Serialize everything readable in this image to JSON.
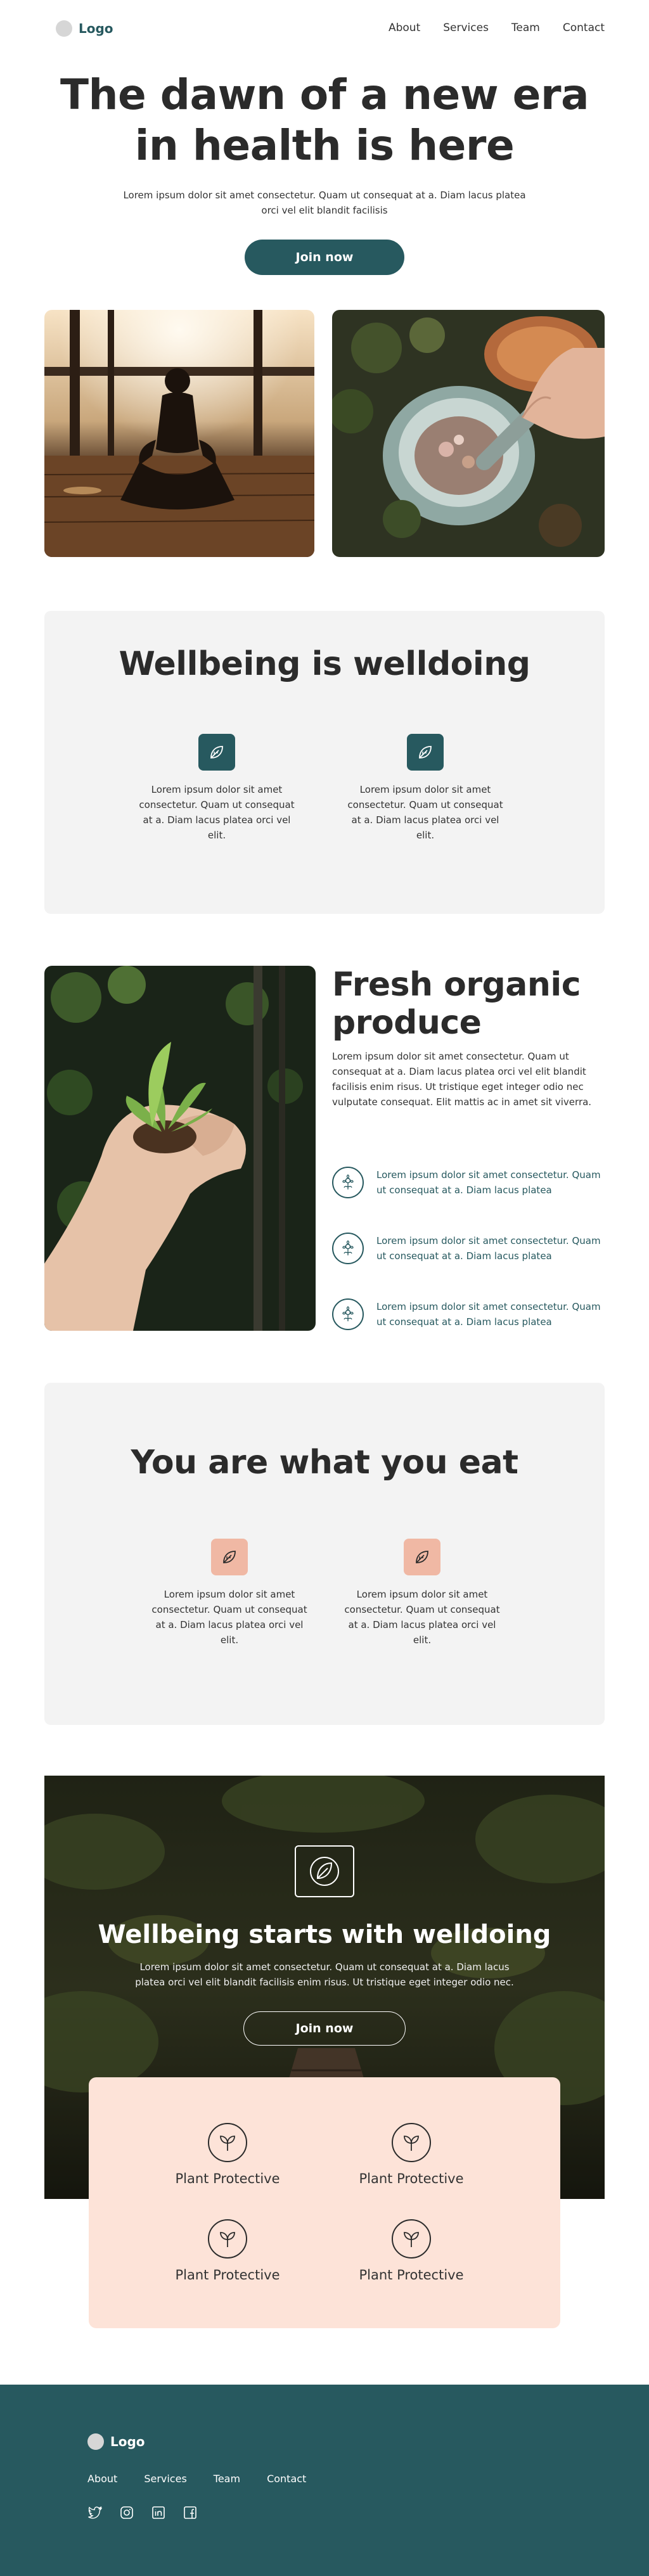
{
  "nav": {
    "logo": "Logo",
    "links": [
      "About",
      "Services",
      "Team",
      "Contact"
    ]
  },
  "hero": {
    "title": "The dawn of a new era in health is here",
    "subtitle": "Lorem ipsum dolor sit amet consectetur. Quam ut consequat at a. Diam lacus platea orci vel elit blandit facilisis",
    "cta": "Join now"
  },
  "wellbeing": {
    "title": "Wellbeing is welldoing",
    "features": [
      {
        "icon": "leaf-icon",
        "text": "Lorem ipsum dolor sit amet consectetur. Quam ut consequat at a. Diam lacus platea orci vel elit."
      },
      {
        "icon": "leaf-icon",
        "text": "Lorem ipsum dolor sit amet consectetur. Quam ut consequat at a. Diam lacus platea orci vel elit."
      }
    ]
  },
  "organic": {
    "title": "Fresh organic produce",
    "body": "Lorem ipsum dolor sit amet consectetur. Quam ut consequat at a. Diam lacus platea orci vel elit blandit facilisis enim risus. Ut tristique eget integer odio nec vulputate consequat. Elit mattis ac in amet sit viverra.",
    "items": [
      {
        "icon": "flower-icon",
        "text": "Lorem ipsum dolor sit amet consectetur. Quam ut consequat at a. Diam lacus platea"
      },
      {
        "icon": "flower-icon",
        "text": "Lorem ipsum dolor sit amet consectetur. Quam ut consequat at a. Diam lacus platea"
      },
      {
        "icon": "flower-icon",
        "text": "Lorem ipsum dolor sit amet consectetur. Quam ut consequat at a. Diam lacus platea"
      }
    ]
  },
  "eat": {
    "title": "You are what you eat",
    "features": [
      {
        "icon": "leaf-icon",
        "text": "Lorem ipsum dolor sit amet consectetur. Quam ut consequat at a. Diam lacus platea orci vel elit."
      },
      {
        "icon": "leaf-icon",
        "text": "Lorem ipsum dolor sit amet consectetur. Quam ut consequat at a. Diam lacus platea orci vel elit."
      }
    ]
  },
  "banner": {
    "title": "Wellbeing starts with welldoing",
    "subtitle": "Lorem ipsum dolor sit amet consectetur. Quam ut consequat at a. Diam lacus platea orci vel elit blandit facilisis enim risus. Ut tristique eget integer odio nec.",
    "cta": "Join now"
  },
  "plants": {
    "items": [
      "Plant Protective",
      "Plant Protective",
      "Plant Protective",
      "Plant Protective"
    ]
  },
  "footer": {
    "logo": "Logo",
    "links": [
      "About",
      "Services",
      "Team",
      "Contact"
    ],
    "social": [
      "twitter-icon",
      "instagram-icon",
      "linkedin-icon",
      "facebook-icon"
    ]
  },
  "colors": {
    "primary": "#27595f",
    "panel": "#f3f3f3",
    "peach": "#fde3d8",
    "peach_icon": "#f0b8a4"
  }
}
